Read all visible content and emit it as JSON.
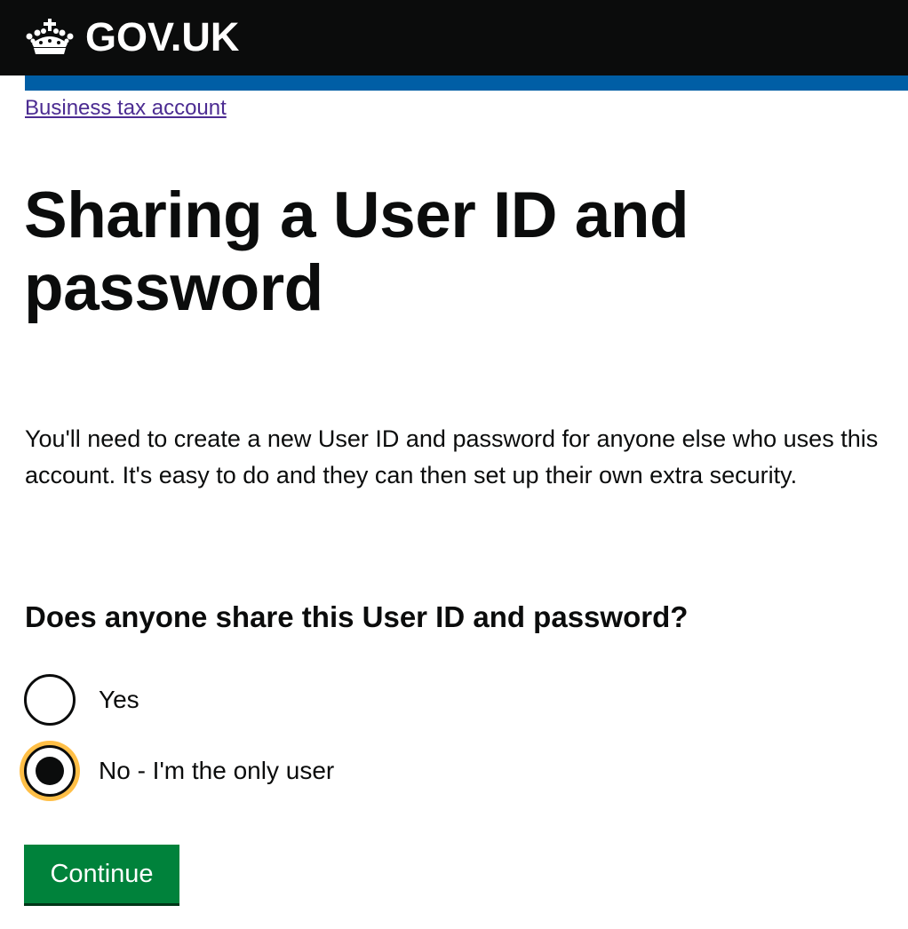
{
  "header": {
    "logo_text": "GOV.UK",
    "logo_icon": "crown-icon"
  },
  "breadcrumb": {
    "link_label": "Business tax account"
  },
  "page": {
    "title": "Sharing a User ID and password",
    "lead": "You'll need to create a new User ID and password for anyone else who uses this account. It's easy to do and they can then set up their own extra security.",
    "question": "Does anyone share this User ID and password?"
  },
  "radios": {
    "selected": "no",
    "options": [
      {
        "value": "yes",
        "label": "Yes",
        "checked": false
      },
      {
        "value": "no",
        "label": "No - I'm the only user",
        "checked": true
      }
    ]
  },
  "actions": {
    "continue_label": "Continue"
  },
  "colors": {
    "header_bg": "#0b0c0c",
    "accent_bar": "#005ea5",
    "link": "#4c2c92",
    "focus": "#ffbf47",
    "button": "#00823b"
  }
}
